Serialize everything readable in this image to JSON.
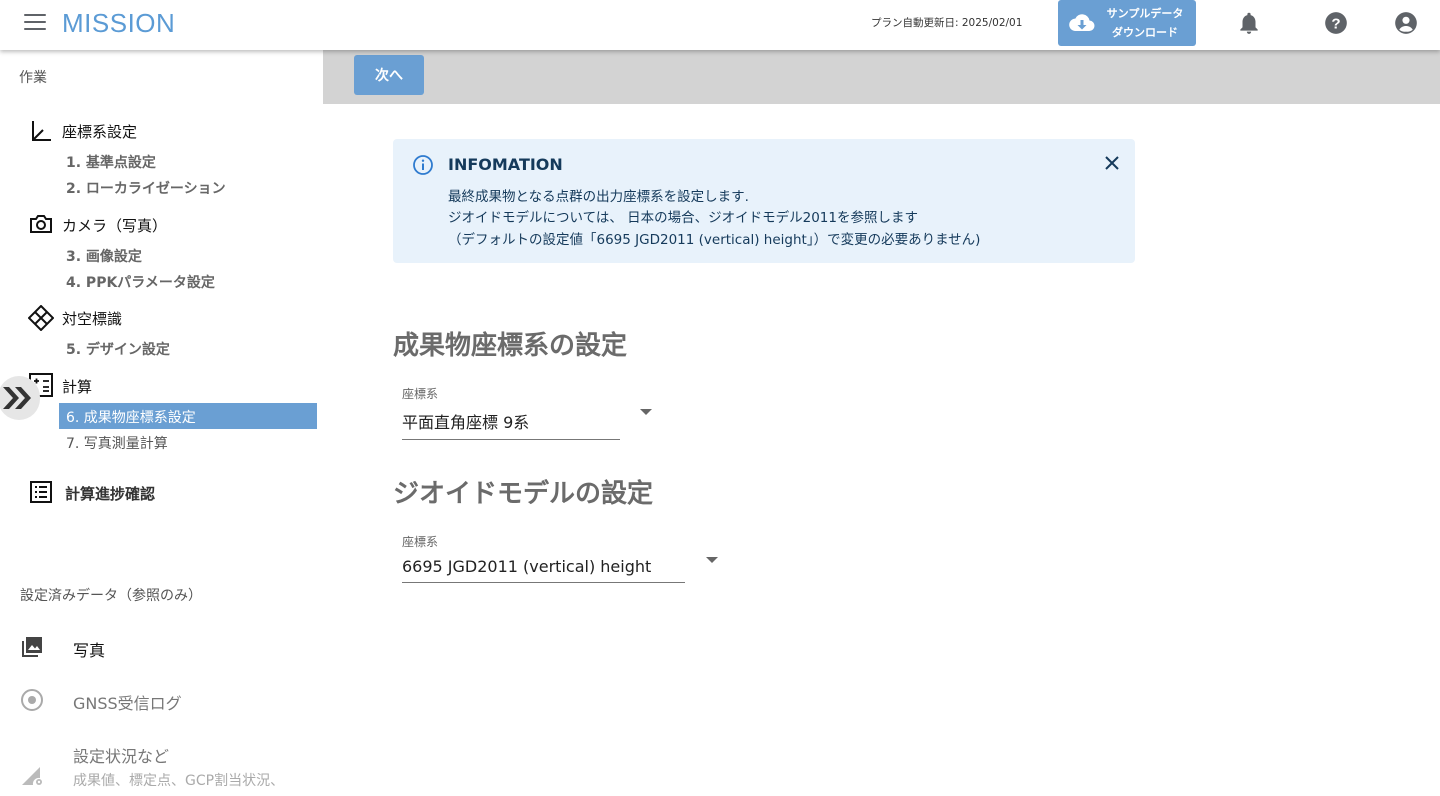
{
  "header": {
    "logo": "MISSION",
    "plan_update": "プラン自動更新日: 2025/02/01",
    "sample_download_line1": "サンプルデータ",
    "sample_download_line2": "ダウンロード"
  },
  "sidebar": {
    "work_heading": "作業",
    "categories": {
      "coord": "座標系設定",
      "camera": "カメラ（写真）",
      "gcp": "対空標識",
      "calc": "計算",
      "progress": "計算進捗確認"
    },
    "items": {
      "i1": "1. 基準点設定",
      "i2": "2. ローカライゼーション",
      "i3": "3. 画像設定",
      "i4": "4. PPKパラメータ設定",
      "i5": "5. デザイン設定",
      "i6": "6. 成果物座標系設定",
      "i7": "7. 写真測量計算"
    },
    "ref_heading": "設定済みデータ（参照のみ）",
    "refs": {
      "photo": "写真",
      "gnss": "GNSS受信ログ",
      "status": "設定状況など",
      "status_sub": "成果値、標定点、GCP割当状況、"
    }
  },
  "toolbar": {
    "next_label": "次へ"
  },
  "info": {
    "title": "INFOMATION",
    "line1": "最終成果物となる点群の出力座標系を設定します.",
    "line2": "ジオイドモデルについては、 日本の場合、ジオイドモデル2011を参照します",
    "line3": "（デフォルトの設定値「6695 JGD2011 (vertical) height」）で変更の必要ありません)"
  },
  "output_crs": {
    "title": "成果物座標系の設定",
    "label": "座標系",
    "value": "平面直角座標 9系"
  },
  "geoid": {
    "title": "ジオイドモデルの設定",
    "label": "座標系",
    "value": "6695 JGD2011 (vertical) height"
  },
  "colors": {
    "accent": "#6a9fd3",
    "logo": "#5b9bd5",
    "info_bg": "#e8f2fb",
    "toolbar_bg": "#d3d3d3"
  }
}
